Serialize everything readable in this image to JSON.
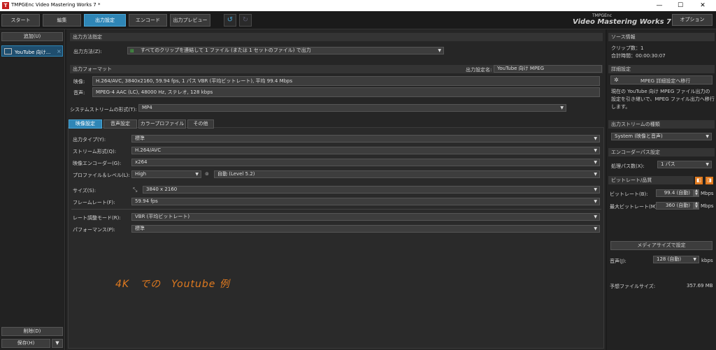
{
  "window": {
    "title": "TMPGEnc Video Mastering Works 7 *",
    "minimize": "—",
    "maximize": "☐",
    "close": "✕",
    "logo": "T"
  },
  "toolbar": {
    "tabs": [
      "スタート",
      "編集",
      "出力設定",
      "エンコード",
      "出力プレビュー"
    ],
    "active_tab": "出力設定",
    "undo_icon": "undo-icon",
    "redo_icon": "redo-icon",
    "brand_small": "TMPGEnc",
    "brand_large": "Video Mastering Works 7",
    "options": "オプション"
  },
  "left": {
    "add": "追加(U)",
    "clip_name": "YouTube 向け...",
    "clip_close": "×",
    "delete": "削除(D)",
    "save": "保存(H)",
    "save_arrow": "▼"
  },
  "output_method": {
    "header": "出力方法指定",
    "label": "出力方法(Z):",
    "value": "すべてのクリップを連結して 1 ファイル (または 1 セットのファイル) で出力"
  },
  "output_format": {
    "header": "出力フォーマット",
    "name_label": "出力設定名:",
    "name_value": "YouTube 向け MPEG",
    "video_label": "映像:",
    "video_value": "H.264/AVC, 3840x2160, 59.94 fps, 1 パス VBR (平均ビットレート), 平均 99.4 Mbps",
    "audio_label": "音声:",
    "audio_value": "MPEG-4 AAC (LC), 48000 Hz, ステレオ, 128 kbps"
  },
  "system_stream": {
    "label": "システムストリームの形式(T):",
    "value": "MP4"
  },
  "tabs": [
    "映像設定",
    "音声設定",
    "カラープロファイル",
    "その他"
  ],
  "active_settings_tab": "映像設定",
  "video": {
    "output_type_label": "出力タイプ(Y):",
    "output_type": "標準",
    "stream_label": "ストリーム形式(Q):",
    "stream": "H.264/AVC",
    "encoder_label": "映像エンコーダー(G):",
    "encoder": "x264",
    "profile_label": "プロファイル＆レベル(L):",
    "profile": "High",
    "level_icon": "chain-icon",
    "level": "自動 (Level 5.2)",
    "size_label": "サイズ(S):",
    "size": "3840 x 2160",
    "fps_label": "フレームレート(F):",
    "fps": "59.94 fps",
    "rate_label": "レート調整モード(R):",
    "rate": "VBR (平均ビットレート)",
    "perf_label": "パフォーマンス(P):",
    "perf": "標準"
  },
  "annotation": "4K　での　Youtube 例",
  "right": {
    "source_header": "ソース情報",
    "clip_count": "クリップ数：1",
    "total_time": "合計時間：00:00:30:07",
    "detail_header": "詳細設定",
    "detail_button": "MPEG 詳細設定へ移行",
    "detail_text": "現在の YouTube 向け MPEG ファイル出力の設定を引き継いで、MPEG ファイル出力へ移行します。",
    "stream_kind_header": "出力ストリームの種類",
    "stream_kind": "System (映像と音声)",
    "pass_header": "エンコーダーパス設定",
    "pass_label": "処理パス数(X):",
    "pass_value": "1 パス",
    "bitrate_header": "ビットレート/品質",
    "bitrate_label": "ビットレート(B):",
    "bitrate": "99.4 (自動)",
    "unit": "Mbps",
    "max_bitrate_label": "最大ビットレート(M):",
    "max_bitrate": "360 (自動)",
    "media_size_button": "メディアサイズで設定",
    "audio_label": "音声(J):",
    "audio_value": "128 (自動)",
    "audio_unit": "kbps",
    "est_label": "予想ファイルサイズ:",
    "est_value": "357.69 MB"
  }
}
